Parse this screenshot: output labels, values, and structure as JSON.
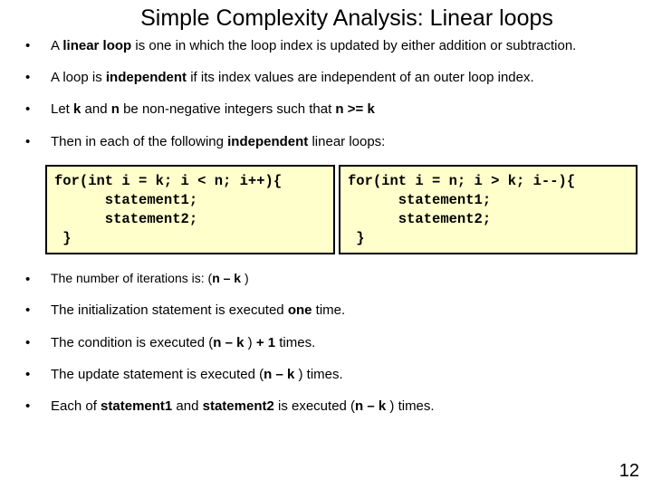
{
  "title": "Simple Complexity Analysis: Linear loops",
  "bullets": {
    "b1_pre": "A ",
    "b1_bold": "linear loop",
    "b1_post": " is one in which the loop index is updated by either addition or subtraction.",
    "b2_pre": "A loop is ",
    "b2_bold": "independent",
    "b2_post": " if its index values are independent of an outer loop index.",
    "b3_pre": "Let ",
    "b3_k": "k",
    "b3_mid1": " and ",
    "b3_n": "n",
    "b3_mid2": " be non-negative integers such that ",
    "b3_cond": "n >= k",
    "b4_pre": "Then in each of the following ",
    "b4_bold": "independent",
    "b4_post": " linear loops:",
    "b5_pre": "The number of iterations is:  (",
    "b5_bold": "n – k",
    "b5_post": " )",
    "b6_pre": "The initialization statement is executed ",
    "b6_bold": "one",
    "b6_post": " time.",
    "b7_pre": "The condition is executed (",
    "b7_bold": "n – k",
    "b7_mid": " ) ",
    "b7_bold2": "+  1",
    "b7_post": " times.",
    "b8_pre": "The update statement is executed (",
    "b8_bold": "n – k",
    "b8_post": " )  times.",
    "b9_pre": "Each of ",
    "b9_bold1": "statement1",
    "b9_mid": " and ",
    "b9_bold2": "statement2",
    "b9_mid2": " is executed (",
    "b9_bold3": "n – k",
    "b9_post": " ) times."
  },
  "code": {
    "left": "for(int i = k; i < n; i++){\n      statement1;\n      statement2;\n }",
    "right": "for(int i = n; i > k; i--){\n      statement1;\n      statement2;\n }"
  },
  "page_number": "12"
}
